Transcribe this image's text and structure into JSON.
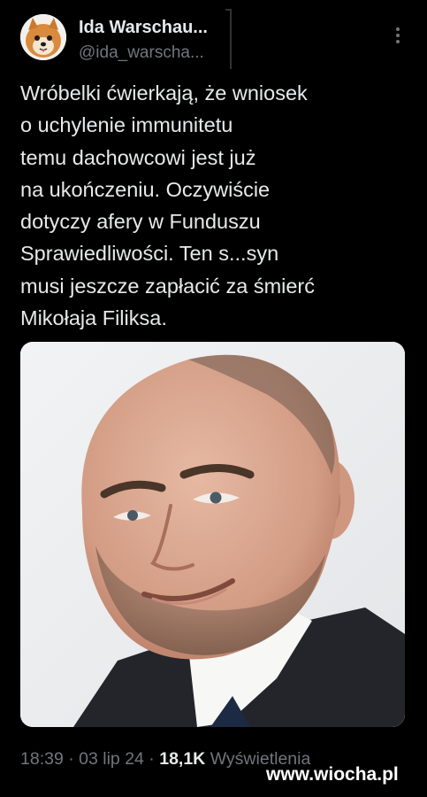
{
  "author": {
    "name": "Ida Warschau...",
    "handle": "@ida_warscha...",
    "avatar_icon": "dog-avatar"
  },
  "menu": {
    "icon": "more-vertical-icon"
  },
  "tweet": {
    "lines": [
      "Wróbelki ćwierkają, że wniosek",
      "o uchylenie immunitetu",
      "temu dachowcowi jest już",
      "na ukończeniu. Oczywiście",
      "dotyczy afery w Funduszu",
      "Sprawiedliwości. Ten s...syn",
      "musi jeszcze zapłacić za śmierć",
      "Mikołaja Filiksa."
    ]
  },
  "media": {
    "kind": "photo"
  },
  "meta": {
    "time": "18:39",
    "sep1": " · ",
    "date": "03 lip 24",
    "sep2": " · ",
    "views_count": "18,1K",
    "views_label": " Wyświetlenia"
  },
  "watermark": {
    "text": "www.wiocha.pl"
  },
  "colors": {
    "background": "#000000",
    "primary_text": "#e7e9ea",
    "secondary_text": "#71767b",
    "divider": "#2f3336"
  }
}
